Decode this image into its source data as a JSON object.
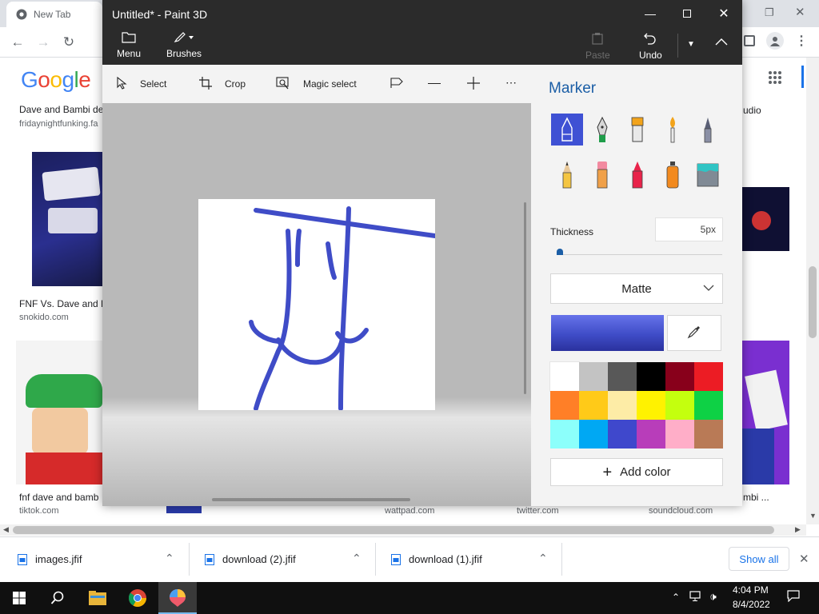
{
  "chrome": {
    "tab_title": "New Tab",
    "logo_text": "Google",
    "results": [
      {
        "title": "Dave and Bambi de",
        "source": "fridaynightfunking.fa"
      },
      {
        "title": "FNF Vs. Dave and B",
        "source": "snokido.com"
      },
      {
        "title": "fnf dave and bamb",
        "source": "tiktok.com"
      },
      {
        "title": "",
        "source": "wattpad.com"
      },
      {
        "title": "",
        "source": "twitter.com"
      },
      {
        "title": "",
        "source": "soundcloud.com"
      },
      {
        "title": "udio",
        "source": ""
      },
      {
        "title": "mbi ...",
        "source": ""
      }
    ]
  },
  "paint3d": {
    "window_title": "Untitled* - Paint 3D",
    "ribbon": {
      "menu": "Menu",
      "brushes": "Brushes",
      "paste": "Paste",
      "undo": "Undo"
    },
    "toolbar": {
      "select": "Select",
      "crop": "Crop",
      "magic_select": "Magic select"
    },
    "panel": {
      "title": "Marker",
      "thickness_label": "Thickness",
      "thickness_value": "5px",
      "thickness_fraction": 0.05,
      "finish": "Matte",
      "current_color": "#3f4cc7",
      "add_color": "Add color",
      "palette": [
        "#ffffff",
        "#c3c3c3",
        "#585858",
        "#000000",
        "#88001b",
        "#ec1c24",
        "#ff7f27",
        "#ffca18",
        "#fdeca6",
        "#fff200",
        "#c4ff0e",
        "#0ed145",
        "#8cfffb",
        "#00a8f3",
        "#3f48cc",
        "#b83dba",
        "#ffaec8",
        "#b97a56"
      ]
    }
  },
  "downloads": {
    "items": [
      "images.jfif",
      "download (2).jfif",
      "download (1).jfif"
    ],
    "show_all": "Show all"
  },
  "taskbar": {
    "time": "4:04 PM",
    "date": "8/4/2022"
  }
}
